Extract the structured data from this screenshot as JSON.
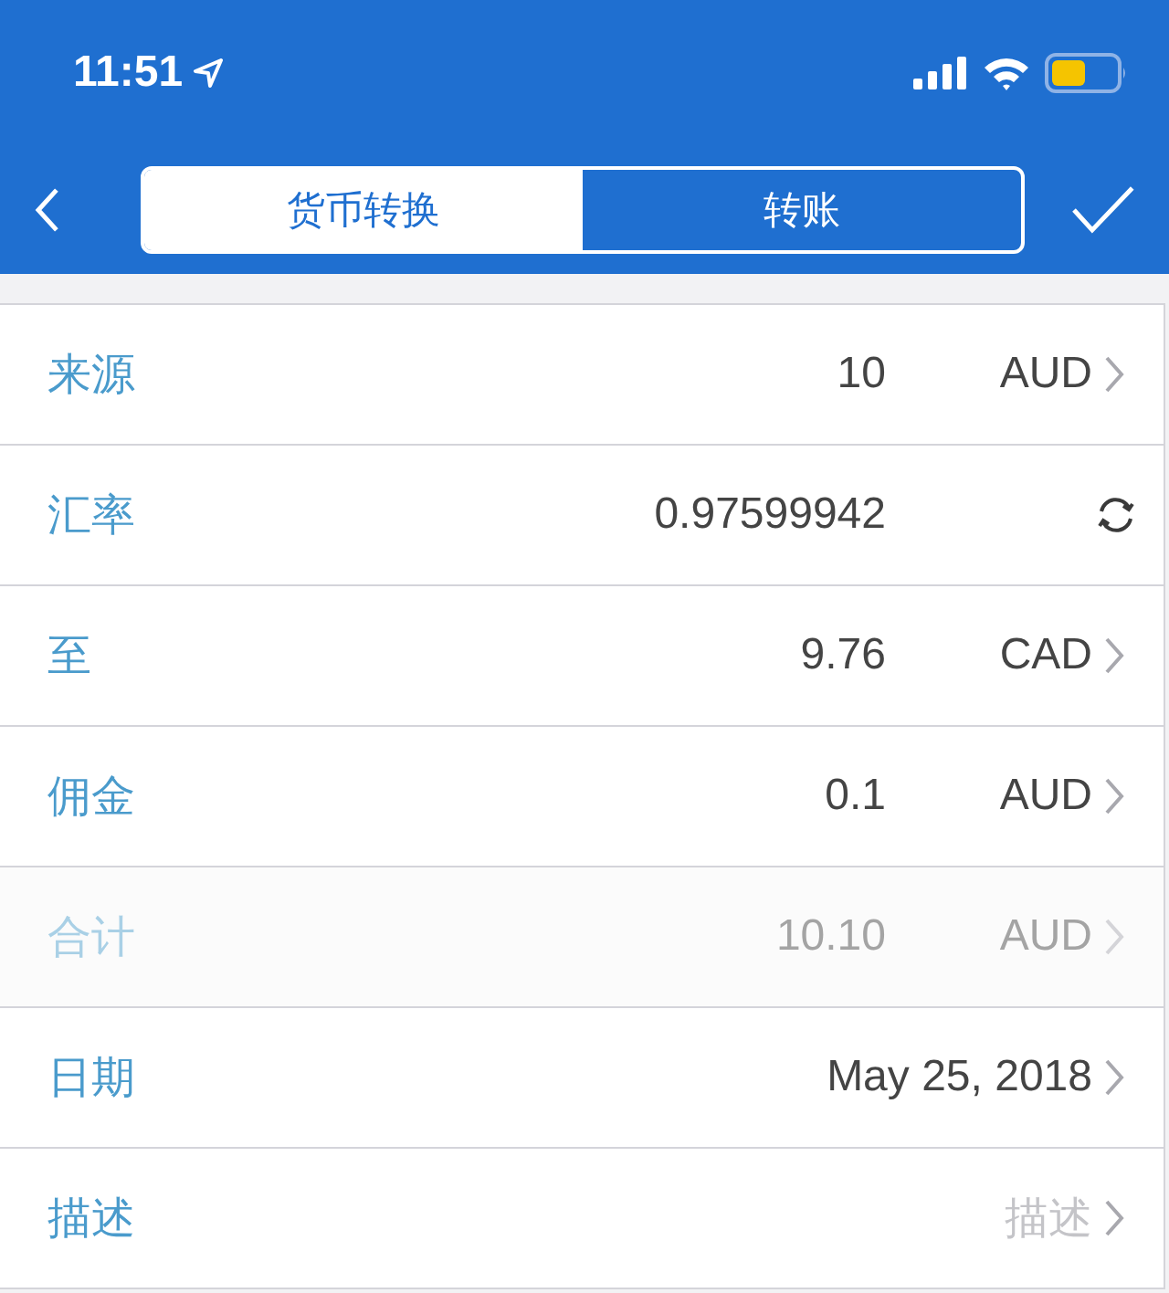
{
  "status_bar": {
    "time": "11:51"
  },
  "tabs": [
    {
      "label": "货币转换",
      "selected": true
    },
    {
      "label": "转账",
      "selected": false
    }
  ],
  "rows": [
    {
      "label": "来源",
      "kind": "currency",
      "value": "10",
      "currency": "AUD",
      "disabled": false
    },
    {
      "label": "汇率",
      "kind": "refresh",
      "value": "0.97599942",
      "disabled": false
    },
    {
      "label": "至",
      "kind": "currency",
      "value": "9.76",
      "currency": "CAD",
      "disabled": false
    },
    {
      "label": "佣金",
      "kind": "currency",
      "value": "0.1",
      "currency": "AUD",
      "disabled": false
    },
    {
      "label": "合计",
      "kind": "currency",
      "value": "10.10",
      "currency": "AUD",
      "disabled": true
    },
    {
      "label": "日期",
      "kind": "link",
      "value": "May 25, 2018",
      "disabled": false
    },
    {
      "label": "描述",
      "kind": "link",
      "placeholder": "描述",
      "disabled": false
    }
  ]
}
